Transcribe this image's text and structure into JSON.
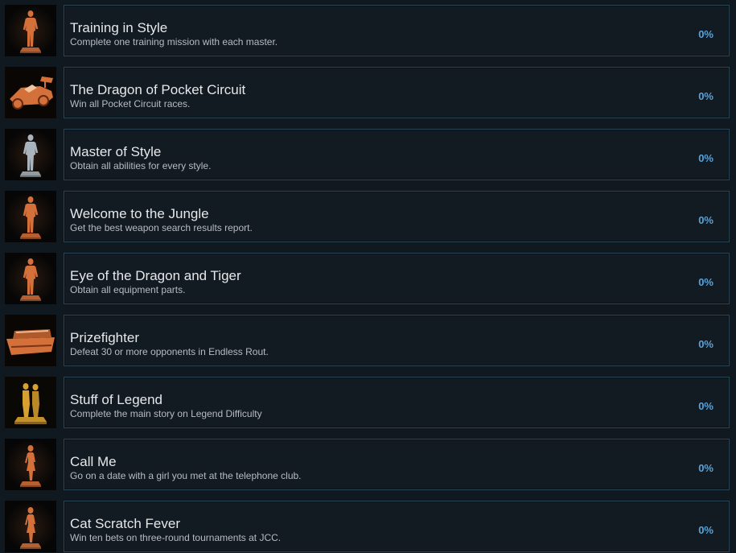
{
  "achievements": [
    {
      "title": "Training in Style",
      "description": "Complete one training mission with each master.",
      "percent": "0%",
      "icon": "bronze-man-figure-icon",
      "tint": "bronze"
    },
    {
      "title": "The Dragon of Pocket Circuit",
      "description": "Win all Pocket Circuit races.",
      "percent": "0%",
      "icon": "bronze-race-car-icon",
      "tint": "bronze"
    },
    {
      "title": "Master of Style",
      "description": "Obtain all abilities for every style.",
      "percent": "0%",
      "icon": "silver-man-figure-icon",
      "tint": "silver"
    },
    {
      "title": "Welcome to the Jungle",
      "description": "Get the best weapon search results report.",
      "percent": "0%",
      "icon": "bronze-man-figure-icon",
      "tint": "bronze"
    },
    {
      "title": "Eye of the Dragon and Tiger",
      "description": "Obtain all equipment parts.",
      "percent": "0%",
      "icon": "bronze-man-figure-icon",
      "tint": "bronze"
    },
    {
      "title": "Prizefighter",
      "description": "Defeat 30 or more opponents in Endless Rout.",
      "percent": "0%",
      "icon": "bronze-boat-icon",
      "tint": "bronze"
    },
    {
      "title": "Stuff of Legend",
      "description": "Complete the main story on Legend Difficulty",
      "percent": "0%",
      "icon": "gold-two-figures-icon",
      "tint": "gold"
    },
    {
      "title": "Call Me",
      "description": "Go on a date with a girl you met at the telephone club.",
      "percent": "0%",
      "icon": "bronze-woman-figure-icon",
      "tint": "bronze"
    },
    {
      "title": "Cat Scratch Fever",
      "description": "Win ten bets on three-round tournaments at JCC.",
      "percent": "0%",
      "icon": "bronze-woman-figure-icon",
      "tint": "bronze"
    }
  ],
  "colors": {
    "bronze": "#d4703a",
    "silver": "#aab4bc",
    "gold": "#d8a030",
    "percent": "#57a4dc",
    "border": "#2a4454"
  }
}
